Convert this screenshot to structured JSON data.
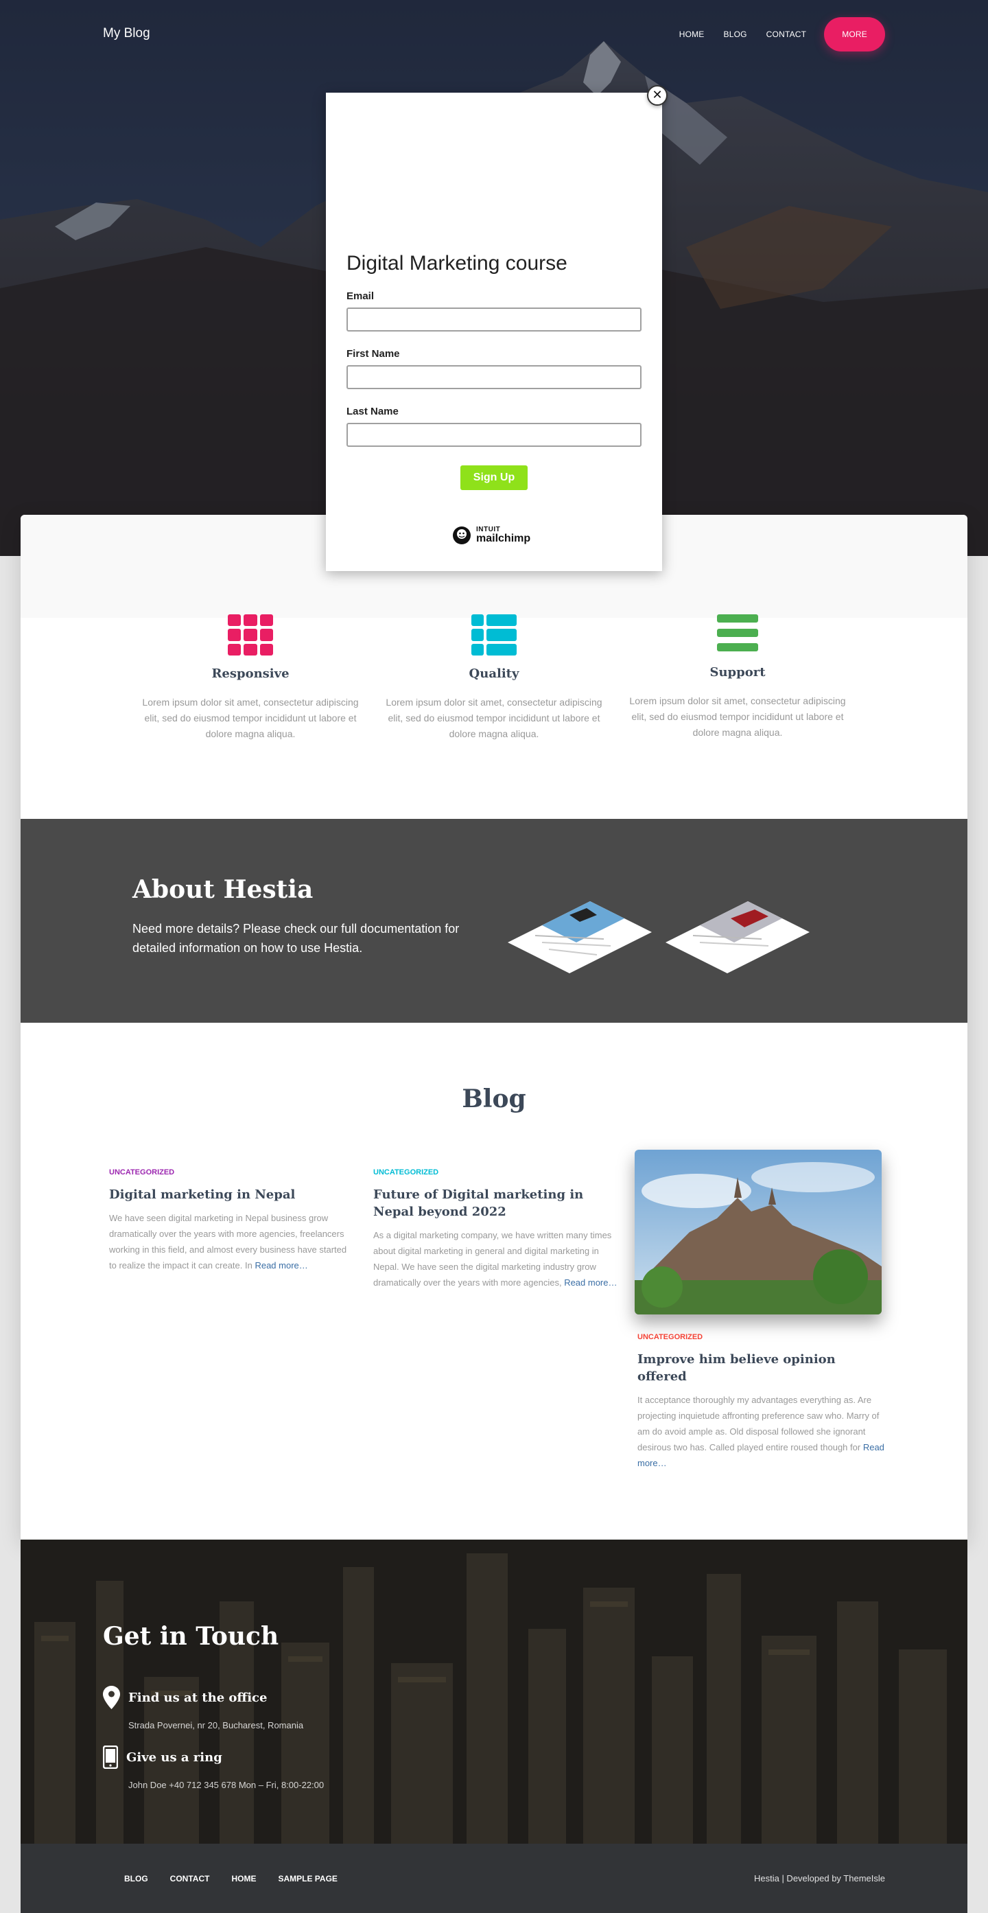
{
  "header": {
    "brand": "My Blog",
    "nav": [
      "HOME",
      "BLOG",
      "CONTACT"
    ],
    "more_label": "MORE"
  },
  "modal": {
    "close_glyph": "✕",
    "title": "Digital Marketing course",
    "fields": [
      {
        "label": "Email",
        "value": ""
      },
      {
        "label": "First Name",
        "value": ""
      },
      {
        "label": "Last Name",
        "value": ""
      }
    ],
    "submit_label": "Sign Up",
    "brand_top": "INTUIT",
    "brand_bottom": "mailchimp"
  },
  "features": [
    {
      "title": "Responsive",
      "text": "Lorem ipsum dolor sit amet, consectetur adipiscing elit, sed do eiusmod tempor incididunt ut labore et dolore magna aliqua.",
      "color": "#e91e63",
      "icon": "grid-icon"
    },
    {
      "title": "Quality",
      "text": "Lorem ipsum dolor sit amet, consectetur adipiscing elit, sed do eiusmod tempor incididunt ut labore et dolore magna aliqua.",
      "color": "#00bcd4",
      "icon": "list-view-icon"
    },
    {
      "title": "Support",
      "text": "Lorem ipsum dolor sit amet, consectetur adipiscing elit, sed do eiusmod tempor incididunt ut labore et dolore magna aliqua.",
      "color": "#4caf50",
      "icon": "menu-lines-icon"
    }
  ],
  "about": {
    "title": "About Hestia",
    "text": "Need more details? Please check our full documentation for detailed information on how to use Hestia."
  },
  "blog": {
    "title": "Blog",
    "posts": [
      {
        "category": "UNCATEGORIZED",
        "category_color": "#9c27b0",
        "title": "Digital marketing in Nepal",
        "excerpt": "We have seen digital marketing in Nepal business grow dramatically over the years with more agencies, freelancers working in this field, and almost every business have started to realize the impact it can create. In",
        "read_more": "Read more…"
      },
      {
        "category": "UNCATEGORIZED",
        "category_color": "#00bcd4",
        "title": "Future of Digital marketing in Nepal beyond 2022",
        "excerpt": "As a digital marketing company, we have written many times about digital marketing in general and digital marketing in Nepal.  We have seen the digital marketing industry grow dramatically over the years with more agencies,",
        "read_more": "Read more…"
      },
      {
        "category": "UNCATEGORIZED",
        "category_color": "#f44336",
        "title": "Improve him believe opinion offered",
        "excerpt": "It acceptance thoroughly my advantages everything as. Are projecting inquietude affronting preference saw who. Marry of am do avoid ample as. Old disposal followed she ignorant desirous two has. Called played entire roused though for",
        "read_more": "Read more…"
      }
    ]
  },
  "contact": {
    "title": "Get in Touch",
    "items": [
      {
        "heading": "Find us at the office",
        "detail": "Strada Povernei, nr 20, Bucharest, Romania",
        "icon": "map-pin-icon"
      },
      {
        "heading": "Give us a ring",
        "detail": "John Doe +40 712 345 678 Mon – Fri, 8:00-22:00",
        "icon": "phone-icon"
      }
    ]
  },
  "footer": {
    "nav": [
      "BLOG",
      "CONTACT",
      "HOME",
      "SAMPLE PAGE"
    ],
    "copyright": "Hestia | Developed by ThemeIsle"
  },
  "colors": {
    "accent": "#e91e63",
    "signup": "#8fe11a",
    "about_bg": "#4a4a4a",
    "footer_bg": "#323437"
  }
}
